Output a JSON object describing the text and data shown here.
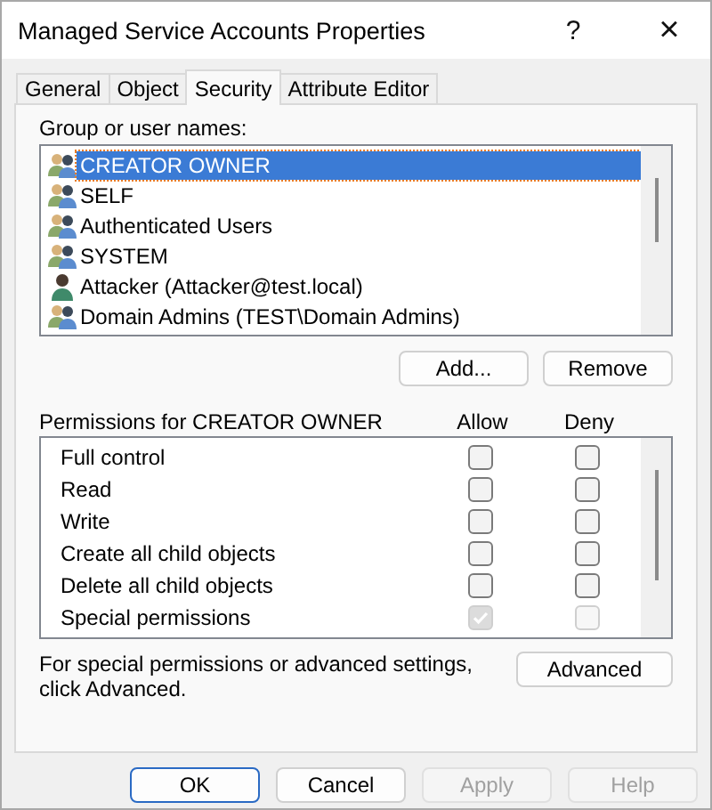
{
  "window": {
    "title": "Managed Service Accounts Properties",
    "help_button": "?",
    "close_button": "×"
  },
  "tabs": [
    {
      "label": "General",
      "selected": false
    },
    {
      "label": "Object",
      "selected": false
    },
    {
      "label": "Security",
      "selected": true
    },
    {
      "label": "Attribute Editor",
      "selected": false
    }
  ],
  "group_label": "Group or user names:",
  "principals": [
    {
      "name": "CREATOR OWNER",
      "kind": "group",
      "selected": true
    },
    {
      "name": "SELF",
      "kind": "group",
      "selected": false
    },
    {
      "name": "Authenticated Users",
      "kind": "group",
      "selected": false
    },
    {
      "name": "SYSTEM",
      "kind": "group",
      "selected": false
    },
    {
      "name": "Attacker (Attacker@test.local)",
      "kind": "user",
      "selected": false
    },
    {
      "name": "Domain Admins (TEST\\Domain Admins)",
      "kind": "group",
      "selected": false
    }
  ],
  "principal_buttons": [
    "Add...",
    "Remove"
  ],
  "permissions_header": {
    "title": "Permissions for CREATOR OWNER",
    "allow": "Allow",
    "deny": "Deny"
  },
  "permissions": [
    {
      "name": "Full control",
      "allow": {
        "checked": false,
        "disabled": false
      },
      "deny": {
        "checked": false,
        "disabled": false
      }
    },
    {
      "name": "Read",
      "allow": {
        "checked": false,
        "disabled": false
      },
      "deny": {
        "checked": false,
        "disabled": false
      }
    },
    {
      "name": "Write",
      "allow": {
        "checked": false,
        "disabled": false
      },
      "deny": {
        "checked": false,
        "disabled": false
      }
    },
    {
      "name": "Create all child objects",
      "allow": {
        "checked": false,
        "disabled": false
      },
      "deny": {
        "checked": false,
        "disabled": false
      }
    },
    {
      "name": "Delete all child objects",
      "allow": {
        "checked": false,
        "disabled": false
      },
      "deny": {
        "checked": false,
        "disabled": false
      }
    },
    {
      "name": "Special permissions",
      "allow": {
        "checked": true,
        "disabled": true
      },
      "deny": {
        "checked": false,
        "disabled": true
      }
    }
  ],
  "advanced_note": "For special permissions or advanced settings, click Advanced.",
  "advanced_button": "Advanced",
  "dialog_buttons": [
    {
      "label": "OK",
      "disabled": false,
      "default": true
    },
    {
      "label": "Cancel",
      "disabled": false,
      "default": false
    },
    {
      "label": "Apply",
      "disabled": true,
      "default": false
    },
    {
      "label": "Help",
      "disabled": true,
      "default": false
    }
  ]
}
